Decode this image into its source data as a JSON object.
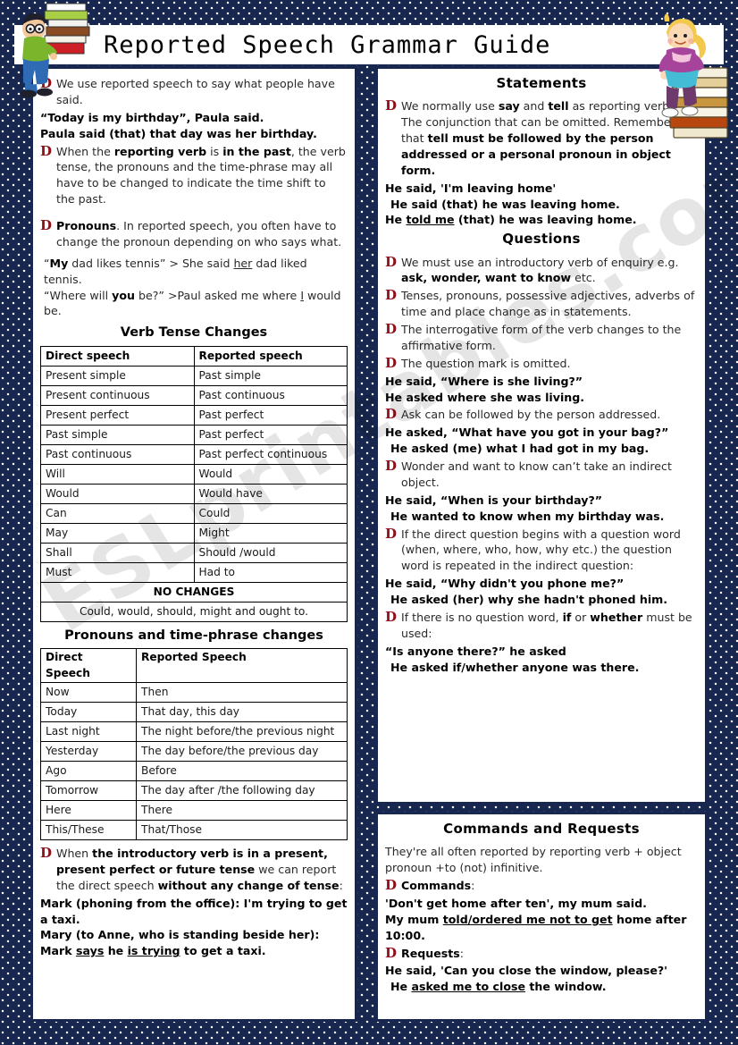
{
  "header": {
    "title": "Reported  Speech Grammar Guide"
  },
  "decor": {
    "boy_with_books": "boy-reading-clipart",
    "girl_on_books": "girl-on-books-clipart",
    "watermark": "ESLprintables.com"
  },
  "left": {
    "intro": {
      "b1": "We use reported speech to say what people have said.",
      "ex1": "“Today is my birthday”, Paula said.",
      "ex2": "Paula said (that) that day was her birthday.",
      "b2_pre": "When the ",
      "b2_bold1": "reporting verb",
      "b2_mid": " is ",
      "b2_bold2": "in the past",
      "b2_post": ", the verb tense, the pronouns and the time-phrase may all have to be changed to indicate the time shift to the past."
    },
    "pronouns": {
      "label": "Pronouns",
      "text": ". In reported speech, you often have to change the pronoun depending on who says what.",
      "ex1_a": "“",
      "ex1_bold": "My",
      "ex1_b": " dad likes tennis” > She said ",
      "ex1_u": "her",
      "ex1_c": " dad liked tennis.",
      "ex2_a": "“Where will ",
      "ex2_bold": "you",
      "ex2_b": " be?” >Paul asked me where ",
      "ex2_u": "I",
      "ex2_c": " would be."
    },
    "verb_tense_heading": "Verb Tense Changes",
    "verb_table": {
      "headers": [
        "Direct speech",
        "Reported speech"
      ],
      "rows": [
        [
          "Present simple",
          "Past simple"
        ],
        [
          "Present continuous",
          "Past continuous"
        ],
        [
          "Present perfect",
          "Past perfect"
        ],
        [
          "Past simple",
          "Past perfect"
        ],
        [
          "Past continuous",
          "Past perfect continuous"
        ],
        [
          "Will",
          "Would"
        ],
        [
          "Would",
          "Would  have"
        ],
        [
          "Can",
          "Could"
        ],
        [
          "May",
          "Might"
        ],
        [
          "Shall",
          "Should /would"
        ],
        [
          "Must",
          "Had to"
        ]
      ],
      "footer_title": "NO CHANGES",
      "footer_sub": "Could, would, should, might and ought to."
    },
    "pronoun_time_heading": "Pronouns and time-phrase changes",
    "time_table": {
      "headers": [
        "Direct Speech",
        "Reported Speech"
      ],
      "rows": [
        [
          "Now",
          "Then"
        ],
        [
          "Today",
          "That day, this day"
        ],
        [
          "Last night",
          "The night before/the previous night"
        ],
        [
          "Yesterday",
          "The day before/the previous day"
        ],
        [
          "Ago",
          "Before"
        ],
        [
          "Tomorrow",
          "The day after /the following day"
        ],
        [
          "Here",
          "There"
        ],
        [
          "This/These",
          "That/Those"
        ]
      ]
    },
    "outro": {
      "pre": "When ",
      "bold1": "the introductory verb is in a present, present perfect or future tense",
      "mid": " we can report the direct speech ",
      "bold2": "without any change of tense",
      "post": ":",
      "ex1": "Mark (phoning from the office): I'm trying to get a taxi.",
      "ex2_a": "Mary (to Anne, who is standing beside her): Mark ",
      "ex2_u1": "says",
      "ex2_b": " he ",
      "ex2_u2": "is trying",
      "ex2_c": " to get a taxi."
    }
  },
  "right": {
    "statements": {
      "heading": "Statements",
      "b1_a": "We normally use ",
      "b1_bold1": "say",
      "b1_b": " and ",
      "b1_bold2": "tell",
      "b1_c": " as reporting verbs. The conjunction that can be omitted. Remember that ",
      "b1_bold3": "tell must be followed by the person addressed or a personal pronoun in object form.",
      "ex1": "He said, 'I'm leaving home'",
      "ex2": "He said (that) he was leaving home.",
      "ex3_a": "He ",
      "ex3_u": "told me",
      "ex3_b": " (that) he was leaving home."
    },
    "questions": {
      "heading": "Questions",
      "b1_a": "We must use an introductory verb of enquiry e.g. ",
      "b1_bold": "ask, wonder, want to know",
      "b1_b": " etc.",
      "b2": "Tenses, pronouns, possessive adjectives, adverbs of time and place change as in statements.",
      "b3": "The interrogative form of the verb changes to the affirmative form.",
      "b4": "The question mark is omitted.",
      "ex1": "He said, “Where is she living?”",
      "ex2": "He asked where she was living.",
      "b5": "Ask can be followed by the person addressed.",
      "ex3": "He asked, “What have you got in your bag?”",
      "ex4": "He asked (me) what I had got in my bag.",
      "b6": "Wonder and want to know can’t take an indirect object.",
      "ex5": "He said, “When is your birthday?”",
      "ex6": "He wanted to know when my birthday was.",
      "b7": "If the direct question begins with a question word (when, where, who, how, why etc.) the question word is repeated in the indirect question:",
      "ex7": "He said, “Why didn't you phone me?”",
      "ex8": "He asked (her) why she hadn't phoned him.",
      "b8_a": "If there is no question word, ",
      "b8_bold1": "if",
      "b8_b": " or ",
      "b8_bold2": "whether",
      "b8_c": " must be used:",
      "ex9": "“Is anyone there?” he asked",
      "ex10": "He asked if/whether anyone was there."
    },
    "commands": {
      "heading": "Commands and Requests",
      "intro": "They're all often reported by reporting verb + object pronoun +to (not) infinitive.",
      "cmd_label": "Commands",
      "cmd_colon": ":",
      "cmd_ex1": "'Don't get home after ten', my mum said.",
      "cmd_ex2_a": "My mum ",
      "cmd_ex2_u": "told/ordered me not to get",
      "cmd_ex2_b": " home after 10:00.",
      "req_label": "Requests",
      "req_colon": ":",
      "req_ex1": "He said, 'Can you close the window, please?'",
      "req_ex2_a": "He ",
      "req_ex2_u": "asked me to close",
      "req_ex2_b": " the window."
    }
  },
  "colors": {
    "navy": "#17274f",
    "bullet_red": "#8e1118"
  }
}
